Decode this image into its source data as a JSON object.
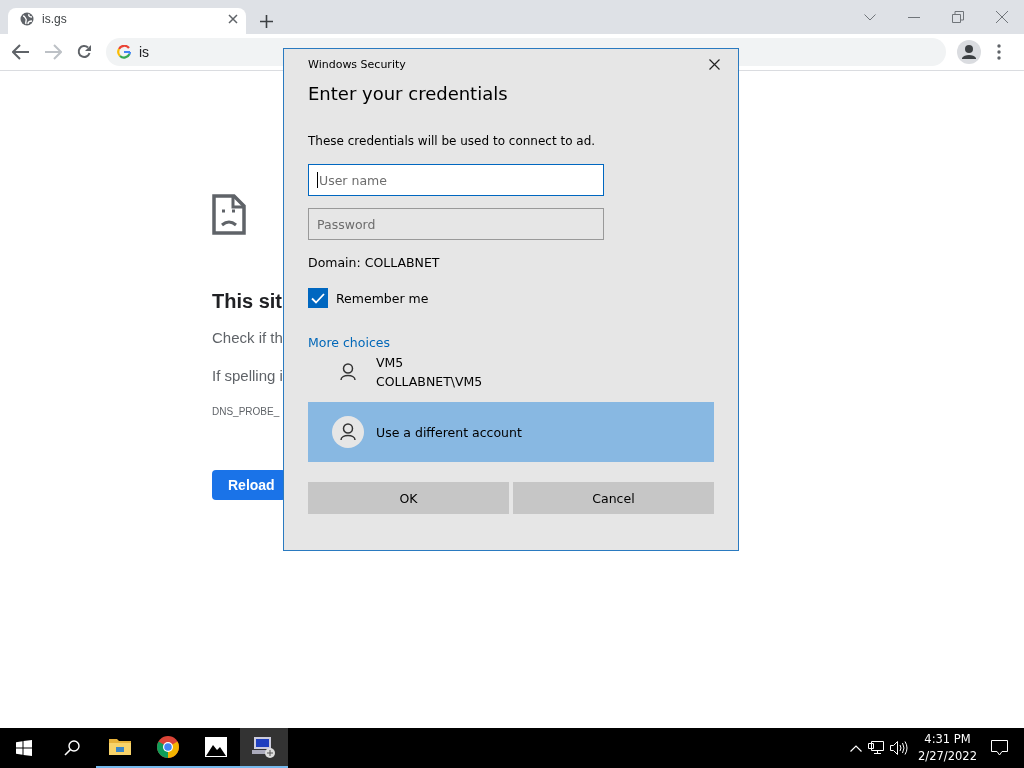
{
  "browser": {
    "tab": {
      "title": "is.gs",
      "selected": true
    },
    "address": "is",
    "forward": {
      "disabled": true
    }
  },
  "error_page": {
    "heading": "This sit",
    "lines": [
      "Check if th",
      "If spelling i"
    ],
    "code": "DNS_PROBE_",
    "button": "Reload"
  },
  "dialog": {
    "caption": "Windows Security",
    "title": "Enter your credentials",
    "message": "These credentials will be used to connect to ad.",
    "fields": [
      {
        "placeholder": "User name",
        "focused": true
      },
      {
        "placeholder": "Password",
        "focused": false
      }
    ],
    "domain": "Domain: COLLABNET",
    "remember": {
      "label": "Remember me",
      "checked": true
    },
    "more_choices": "More choices",
    "accounts": [
      {
        "name": "VM5",
        "detail": "COLLABNET\\VM5",
        "selected": false
      },
      {
        "name": "Use a different account",
        "selected": true
      }
    ],
    "buttons": [
      "OK",
      "Cancel"
    ]
  },
  "taskbar": {
    "apps": [
      {
        "kind": "folder",
        "running": true,
        "selected": false
      },
      {
        "kind": "chrome",
        "running": true,
        "selected": false
      },
      {
        "kind": "photos",
        "running": true,
        "selected": false
      },
      {
        "kind": "remote",
        "running": true,
        "selected": true
      }
    ],
    "time": "4:31 PM",
    "date": "2/27/2022"
  }
}
